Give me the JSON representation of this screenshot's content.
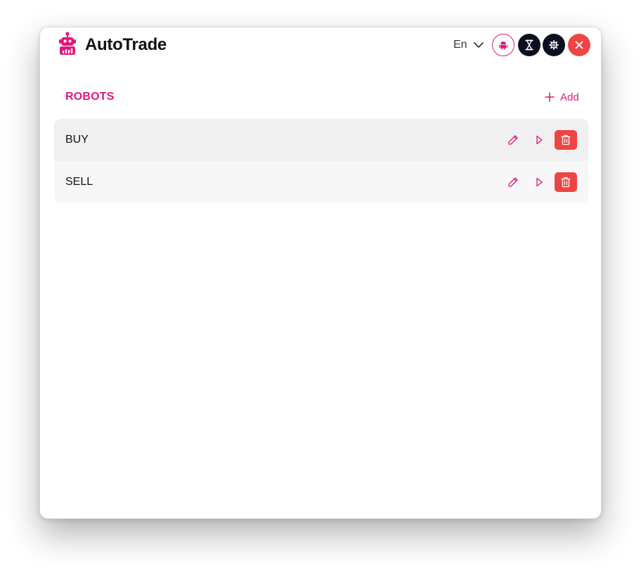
{
  "app": {
    "title": "AutoTrade"
  },
  "header": {
    "language": "En",
    "buttons": [
      {
        "icon": "android-icon"
      },
      {
        "icon": "hourglass-icon"
      },
      {
        "icon": "gear-icon"
      },
      {
        "icon": "close-icon"
      }
    ]
  },
  "robots": {
    "section_title": "ROBOTS",
    "add_label": "Add",
    "items": [
      {
        "name": "BUY"
      },
      {
        "name": "SELL"
      }
    ]
  },
  "colors": {
    "accent": "#e0187c",
    "danger": "#ef4444",
    "dark": "#0b0f1e"
  }
}
